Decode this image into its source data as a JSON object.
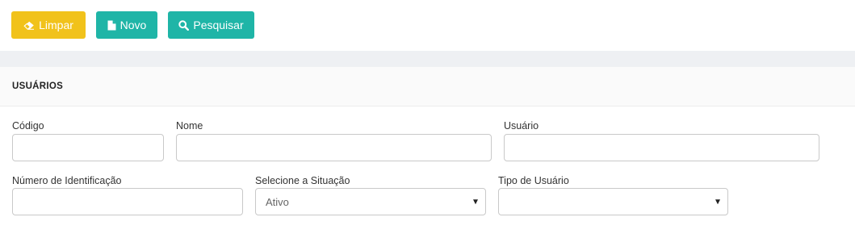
{
  "toolbar": {
    "clear_label": "Limpar",
    "new_label": "Novo",
    "search_label": "Pesquisar",
    "colors": {
      "clear": "#f1c21b",
      "action": "#1fb5a7"
    }
  },
  "panel": {
    "title": "USUÁRIOS"
  },
  "form": {
    "codigo": {
      "label": "Código",
      "value": "",
      "placeholder": ""
    },
    "nome": {
      "label": "Nome",
      "value": "",
      "placeholder": ""
    },
    "usuario": {
      "label": "Usuário",
      "value": "",
      "placeholder": ""
    },
    "numero_identificacao": {
      "label": "Número de Identificação",
      "value": "",
      "placeholder": ""
    },
    "situacao": {
      "label": "Selecione a Situação",
      "selected": "Ativo"
    },
    "tipo_usuario": {
      "label": "Tipo de Usuário",
      "selected": ""
    }
  },
  "icons": {
    "clear": "eraser-icon",
    "new": "file-icon",
    "search": "search-icon",
    "dropdown": "caret-down-icon"
  }
}
